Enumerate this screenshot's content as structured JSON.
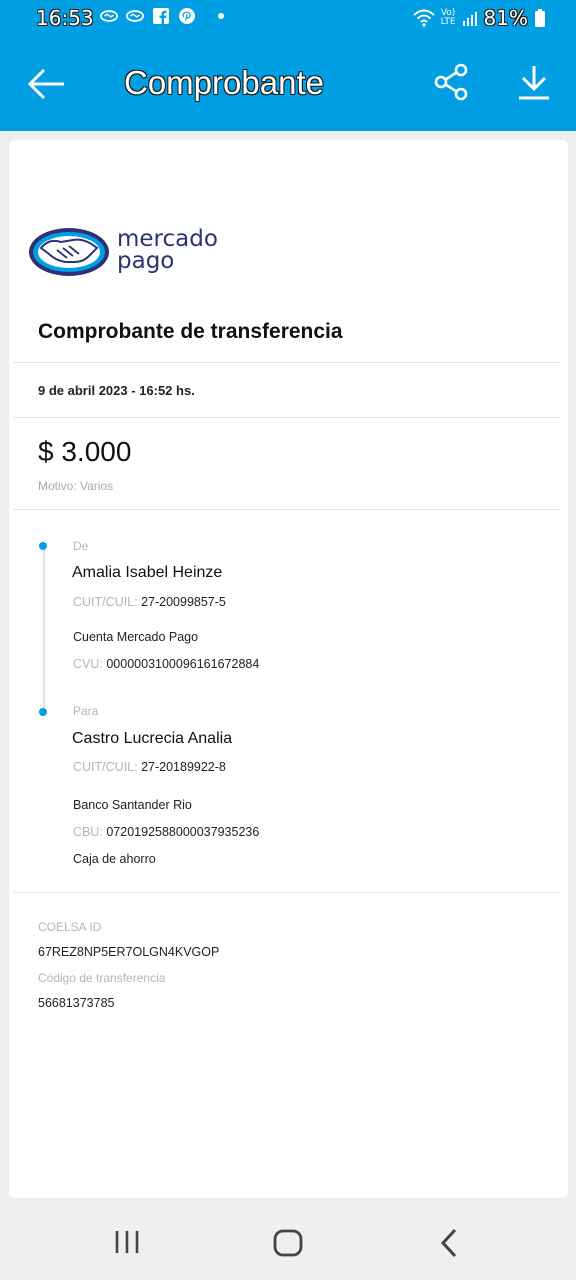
{
  "status_bar": {
    "time": "16:53",
    "battery": "81%",
    "network_top": "Vo)",
    "network_bottom": "LTE",
    "icons": [
      "mercadolibre-icon",
      "mercadolibre-icon",
      "facebook-icon",
      "pinterest-icon",
      "wifi-icon",
      "signal-icon",
      "battery-icon"
    ]
  },
  "app_bar": {
    "title": "Comprobante",
    "icons": [
      "back-arrow-icon",
      "share-icon",
      "download-icon"
    ]
  },
  "receipt": {
    "logo_line1": "mercado",
    "logo_line2": "pago",
    "title": "Comprobante de transferencia",
    "date": "9 de abril 2023 - 16:52 hs.",
    "amount": "$ 3.000",
    "motivo": "Motivo: Varios",
    "from": {
      "label": "De",
      "name": "Amalia Isabel Heinze",
      "id_label": "CUIT/CUIL:",
      "id_value": "27-20099857-5",
      "account": "Cuenta Mercado Pago",
      "cvu_label": "CVU:",
      "cvu_value": "0000003100096161672884"
    },
    "to": {
      "label": "Para",
      "name": "Castro Lucrecia Analia",
      "id_label": "CUIT/CUIL:",
      "id_value": "27-20189922-8",
      "bank": "Banco Santander Rio",
      "cbu_label": "CBU:",
      "cbu_value": "0720192588000037935236",
      "account_type": "Caja de ahorro"
    },
    "coelsa_label": "COELSA ID",
    "coelsa_value": "67REZ8NP5ER7OLGN4KVGOP",
    "code_label": "Código de transferencia",
    "code_value": "56681373785"
  },
  "colors": {
    "brand_blue": "#009ee3",
    "logo_navy": "#2d3277",
    "background": "#efefef"
  },
  "nav_bar": {
    "icons": [
      "recent-apps-icon",
      "home-icon",
      "back-icon"
    ]
  }
}
